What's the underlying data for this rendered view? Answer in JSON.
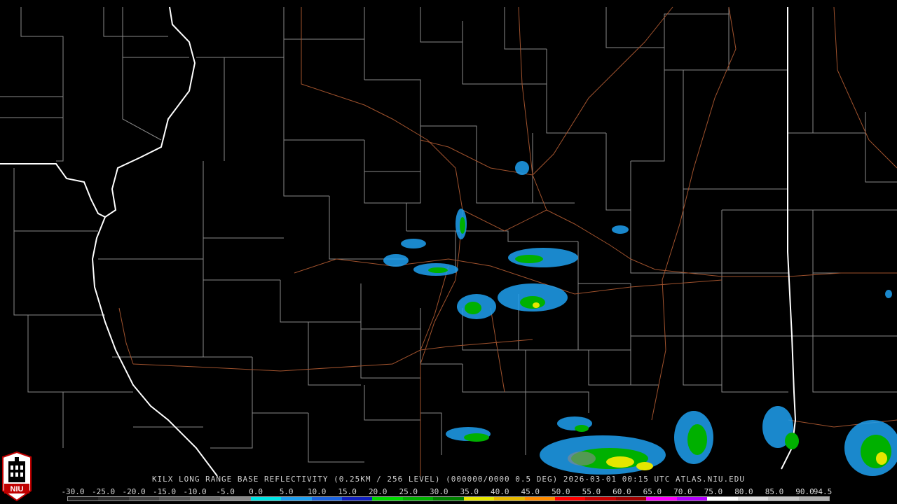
{
  "caption": "KILX LONG RANGE BASE REFLECTIVITY (0.25KM / 256 LEVEL) (000000/0000 0.5 DEG) 2026-03-01 00:15 UTC  ATLAS.NIU.EDU",
  "logo": {
    "text": "NIU",
    "icon": "niu-tower-icon"
  },
  "colorbar": {
    "labels": [
      "-30.0",
      "-25.0",
      "-20.0",
      "-15.0",
      "-10.0",
      "-5.0",
      "0.0",
      "5.0",
      "10.0",
      "15.0",
      "20.0",
      "25.0",
      "30.0",
      "35.0",
      "40.0",
      "45.0",
      "50.0",
      "55.0",
      "60.0",
      "65.0",
      "70.0",
      "75.0",
      "80.0",
      "85.0",
      "90.0",
      "94.5"
    ],
    "colors": [
      "#1c1c1c",
      "#2e2e2e",
      "#444444",
      "#5a5a5a",
      "#707070",
      "#8a8a8a",
      "#00e5e5",
      "#1fa0f0",
      "#1c64e0",
      "#1020c0",
      "#00d800",
      "#00b000",
      "#008000",
      "#e6e600",
      "#e6b800",
      "#ff8c00",
      "#ff0000",
      "#c80000",
      "#a00000",
      "#ff00ff",
      "#b400ff",
      "#ffffff",
      "#e0e0e0",
      "#c8c8c8",
      "#b0b0b0"
    ]
  },
  "colors": {
    "background": "#000000",
    "county_lines": "#8a8a8a",
    "state_lines": "#ffffff",
    "highways": "#a0522d"
  }
}
